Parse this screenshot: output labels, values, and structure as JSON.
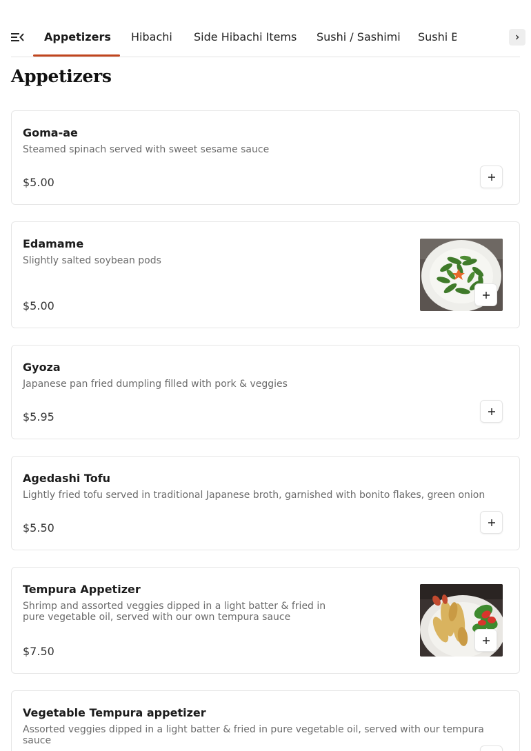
{
  "nav": {
    "tabs": [
      {
        "label": "Appetizers",
        "active": true
      },
      {
        "label": "Hibachi",
        "active": false
      },
      {
        "label": "Side Hibachi Items",
        "active": false
      },
      {
        "label": "Sushi / Sashimi",
        "active": false
      },
      {
        "label": "Sushi Bar Entrees",
        "active": false
      }
    ],
    "accent_color": "#c0451e"
  },
  "section": {
    "title": "Appetizers"
  },
  "items": [
    {
      "name": "Goma-ae",
      "description": "Steamed spinach served with sweet sesame sauce",
      "price": "$5.00",
      "has_image": false
    },
    {
      "name": "Edamame",
      "description": "Slightly salted soybean pods",
      "price": "$5.00",
      "has_image": true
    },
    {
      "name": "Gyoza",
      "description": "Japanese pan fried dumpling filled with pork & veggies",
      "price": "$5.95",
      "has_image": false
    },
    {
      "name": "Agedashi Tofu",
      "description": "Lightly fried tofu served in traditional Japanese broth, garnished with bonito flakes, green onion",
      "price": "$5.50",
      "has_image": false
    },
    {
      "name": "Tempura Appetizer",
      "description": "Shrimp and assorted veggies dipped in a light batter & fried in pure vegetable oil, served with our own tempura sauce",
      "price": "$7.50",
      "has_image": true
    },
    {
      "name": "Vegetable Tempura appetizer",
      "description": "Assorted veggies dipped in a light batter & fried in pure vegetable oil, served with our tempura sauce",
      "price": "",
      "has_image": false
    }
  ]
}
